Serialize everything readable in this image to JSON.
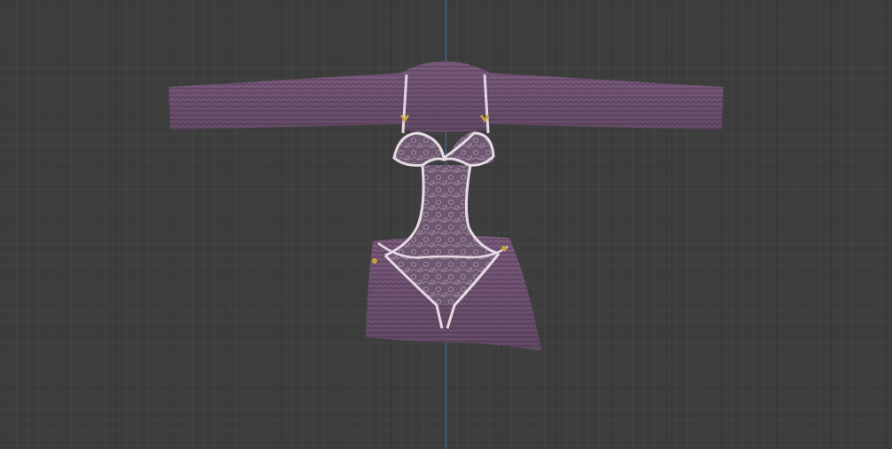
{
  "viewport": {
    "name": "3D Viewport",
    "background": "#3d3d3d",
    "axis_color": "#4a7fb0"
  },
  "model": {
    "object": "lace-bodysuit-outfit",
    "fabric_color": "#6e5070",
    "lace_color": "#8e7590",
    "trim_color": "#ddd0dc",
    "hardware_color": "#c8a53a"
  }
}
